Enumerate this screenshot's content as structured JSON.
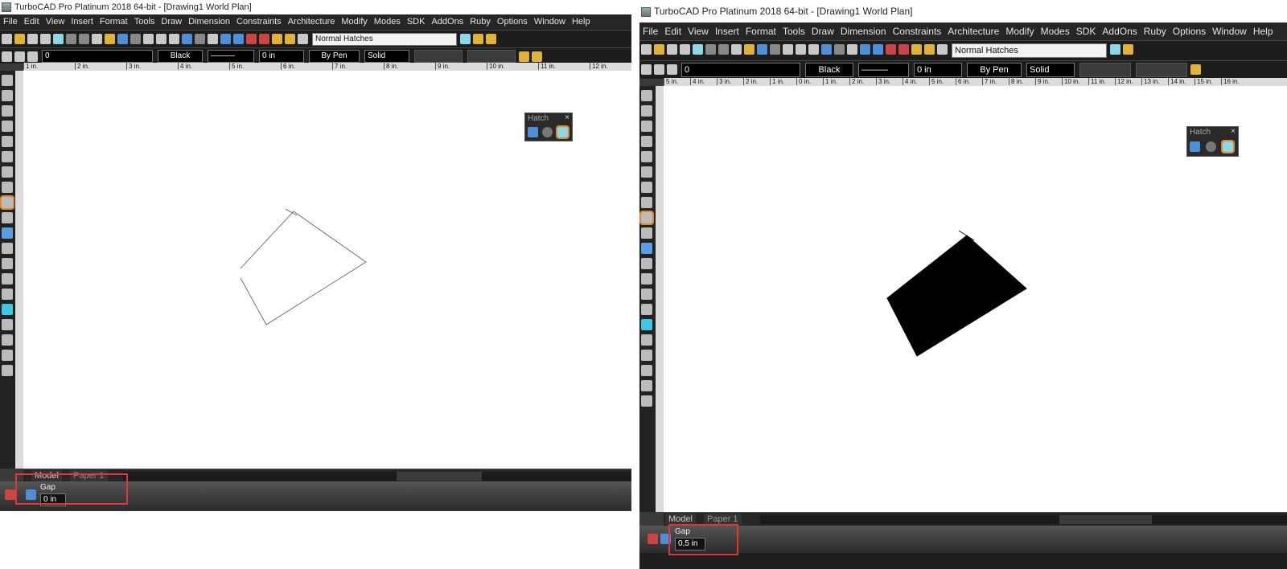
{
  "left": {
    "title": "TurboCAD Pro Platinum 2018 64-bit - [Drawing1 World Plan]",
    "menu": [
      "File",
      "Edit",
      "View",
      "Insert",
      "Format",
      "Tools",
      "Draw",
      "Dimension",
      "Constraints",
      "Architecture",
      "Modify",
      "Modes",
      "SDK",
      "AddOns",
      "Ruby",
      "Options",
      "Window",
      "Help"
    ],
    "hatch_style": "Normal Hatches",
    "layer": "0",
    "color": "Black",
    "thickness": "0 in",
    "pen": "By Pen",
    "line_style": "Solid",
    "ruler_labels": [
      "1 in.",
      "2 in.",
      "3 in.",
      "4 in.",
      "5 in.",
      "6 in.",
      "7 in.",
      "8 in.",
      "9 in.",
      "10 in.",
      "11 in.",
      "12 in."
    ],
    "hatch_panel_title": "Hatch",
    "hatch_panel_close": "×",
    "tabs": [
      "Model",
      "Paper 1"
    ],
    "gap_label": "Gap",
    "gap_value": "0 in"
  },
  "right": {
    "title": "TurboCAD Pro Platinum 2018 64-bit - [Drawing1 World Plan]",
    "menu": [
      "File",
      "Edit",
      "View",
      "Insert",
      "Format",
      "Tools",
      "Draw",
      "Dimension",
      "Constraints",
      "Architecture",
      "Modify",
      "Modes",
      "SDK",
      "AddOns",
      "Ruby",
      "Options",
      "Window",
      "Help"
    ],
    "hatch_style": "Normal Hatches",
    "layer": "0",
    "color": "Black",
    "thickness": "0 in",
    "pen": "By Pen",
    "line_style": "Solid",
    "ruler_labels": [
      "5 in.",
      "4 in.",
      "3 in.",
      "2 in.",
      "1 in.",
      "0 in.",
      "1 in.",
      "2 in.",
      "3 in.",
      "4 in.",
      "5 in.",
      "6 in.",
      "7 in.",
      "8 in.",
      "9 in.",
      "10 in.",
      "11 in.",
      "12 in.",
      "13 in.",
      "14 in.",
      "15 in.",
      "16 in."
    ],
    "hatch_panel_title": "Hatch",
    "hatch_panel_close": "×",
    "tabs": [
      "Model",
      "Paper 1"
    ],
    "gap_label": "Gap",
    "gap_value": "0,5 in"
  },
  "colors": {
    "highlight": "#e0353b",
    "selected_tool": "#e08a2e",
    "hatch_fill": "#000000"
  }
}
